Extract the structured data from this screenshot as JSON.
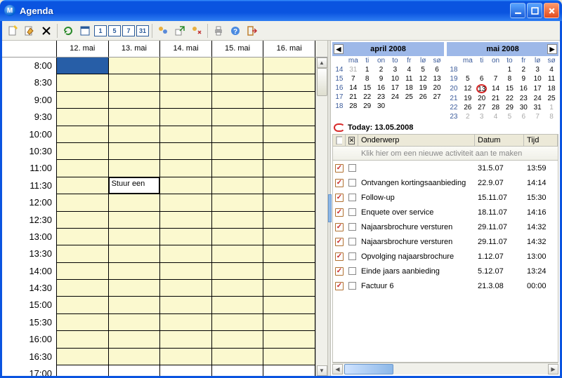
{
  "window": {
    "title": "Agenda",
    "app_icon_letter": "M"
  },
  "toolbar_icons": [
    "new",
    "edit",
    "delete",
    "refresh",
    "day",
    "d1",
    "d5",
    "d7",
    "d31",
    "category",
    "export",
    "print2",
    "print",
    "help",
    "exit"
  ],
  "weekview": {
    "day_headers": [
      "12. mai",
      "13. mai",
      "14. mai",
      "15. mai",
      "16. mai"
    ],
    "time_labels": [
      "8:00",
      "8:30",
      "9:00",
      "9:30",
      "10:00",
      "10:30",
      "11:00",
      "11:30",
      "12:00",
      "12:30",
      "13:00",
      "13:30",
      "14:00",
      "14:30",
      "15:00",
      "15:30",
      "16:00",
      "16:30",
      "17:00"
    ],
    "appointment": {
      "text": "Stuur een",
      "row_index": 7,
      "col_index": 1
    }
  },
  "minicals": [
    {
      "title": "april 2008",
      "has_prev": true,
      "has_next": false,
      "dow": [
        "ma",
        "ti",
        "on",
        "to",
        "fr",
        "lø",
        "sø"
      ],
      "rows": [
        {
          "wk": "14",
          "days": [
            {
              "t": "31",
              "dim": true
            },
            {
              "t": "1"
            },
            {
              "t": "2"
            },
            {
              "t": "3"
            },
            {
              "t": "4"
            },
            {
              "t": "5"
            },
            {
              "t": "6"
            }
          ]
        },
        {
          "wk": "15",
          "days": [
            {
              "t": "7"
            },
            {
              "t": "8"
            },
            {
              "t": "9"
            },
            {
              "t": "10"
            },
            {
              "t": "11"
            },
            {
              "t": "12"
            },
            {
              "t": "13"
            }
          ]
        },
        {
          "wk": "16",
          "days": [
            {
              "t": "14"
            },
            {
              "t": "15"
            },
            {
              "t": "16"
            },
            {
              "t": "17"
            },
            {
              "t": "18"
            },
            {
              "t": "19"
            },
            {
              "t": "20"
            }
          ]
        },
        {
          "wk": "17",
          "days": [
            {
              "t": "21"
            },
            {
              "t": "22"
            },
            {
              "t": "23"
            },
            {
              "t": "24"
            },
            {
              "t": "25"
            },
            {
              "t": "26"
            },
            {
              "t": "27"
            }
          ]
        },
        {
          "wk": "18",
          "days": [
            {
              "t": "28"
            },
            {
              "t": "29"
            },
            {
              "t": "30"
            },
            {
              "t": ""
            },
            {
              "t": ""
            },
            {
              "t": ""
            },
            {
              "t": ""
            }
          ]
        }
      ]
    },
    {
      "title": "mai 2008",
      "has_prev": false,
      "has_next": true,
      "dow": [
        "ma",
        "ti",
        "on",
        "to",
        "fr",
        "lø",
        "sø"
      ],
      "rows": [
        {
          "wk": "18",
          "days": [
            {
              "t": ""
            },
            {
              "t": ""
            },
            {
              "t": ""
            },
            {
              "t": "1"
            },
            {
              "t": "2"
            },
            {
              "t": "3"
            },
            {
              "t": "4"
            }
          ]
        },
        {
          "wk": "19",
          "days": [
            {
              "t": "5"
            },
            {
              "t": "6"
            },
            {
              "t": "7"
            },
            {
              "t": "8"
            },
            {
              "t": "9"
            },
            {
              "t": "10"
            },
            {
              "t": "11"
            }
          ]
        },
        {
          "wk": "20",
          "days": [
            {
              "t": "12"
            },
            {
              "t": "13",
              "today": true
            },
            {
              "t": "14"
            },
            {
              "t": "15"
            },
            {
              "t": "16"
            },
            {
              "t": "17"
            },
            {
              "t": "18"
            }
          ]
        },
        {
          "wk": "21",
          "days": [
            {
              "t": "19"
            },
            {
              "t": "20"
            },
            {
              "t": "21"
            },
            {
              "t": "22"
            },
            {
              "t": "23"
            },
            {
              "t": "24"
            },
            {
              "t": "25"
            }
          ]
        },
        {
          "wk": "22",
          "days": [
            {
              "t": "26"
            },
            {
              "t": "27"
            },
            {
              "t": "28"
            },
            {
              "t": "29"
            },
            {
              "t": "30"
            },
            {
              "t": "31"
            },
            {
              "t": "1",
              "dim": true
            }
          ]
        },
        {
          "wk": "23",
          "days": [
            {
              "t": "2",
              "dim": true
            },
            {
              "t": "3",
              "dim": true
            },
            {
              "t": "4",
              "dim": true
            },
            {
              "t": "5",
              "dim": true
            },
            {
              "t": "6",
              "dim": true
            },
            {
              "t": "7",
              "dim": true
            },
            {
              "t": "8",
              "dim": true
            }
          ]
        }
      ]
    }
  ],
  "today_line": "Today: 13.05.2008",
  "tasklist": {
    "headers": {
      "subject": "Onderwerp",
      "date": "Datum",
      "time": "Tijd"
    },
    "new_placeholder": "Klik hier om een nieuwe activiteit aan te maken",
    "rows": [
      {
        "subject": "",
        "date": "31.5.07",
        "time": "13:59"
      },
      {
        "subject": "Ontvangen kortingsaanbieding",
        "date": "22.9.07",
        "time": "14:14"
      },
      {
        "subject": "Follow-up",
        "date": "15.11.07",
        "time": "15:30"
      },
      {
        "subject": "Enquete over service",
        "date": "18.11.07",
        "time": "14:16"
      },
      {
        "subject": "Najaarsbrochure versturen",
        "date": "29.11.07",
        "time": "14:32"
      },
      {
        "subject": "Najaarsbrochure versturen",
        "date": "29.11.07",
        "time": "14:32"
      },
      {
        "subject": "Opvolging najaarsbrochure",
        "date": "1.12.07",
        "time": "13:00"
      },
      {
        "subject": "Einde jaars aanbieding",
        "date": "5.12.07",
        "time": "13:24"
      },
      {
        "subject": "Factuur 6",
        "date": "21.3.08",
        "time": "00:00"
      }
    ]
  }
}
